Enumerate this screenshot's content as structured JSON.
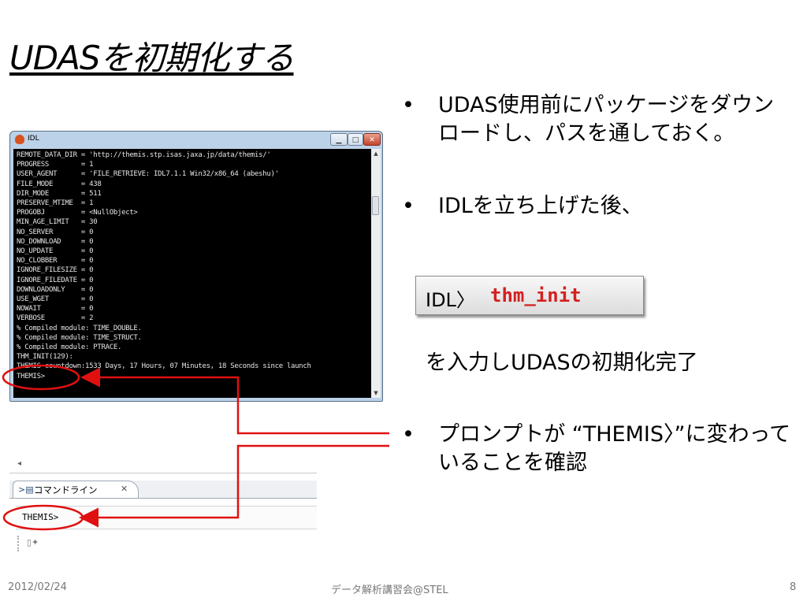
{
  "title": "UDASを初期化する",
  "idl_window": {
    "title": "IDL",
    "console_lines": [
      "REMOTE_DATA_DIR = 'http://themis.stp.isas.jaxa.jp/data/themis/'",
      "PROGRESS        = 1",
      "USER_AGENT      = 'FILE_RETRIEVE: IDL7.1.1 Win32/x86_64 (abeshu)'",
      "FILE_MODE       = 438",
      "DIR_MODE        = 511",
      "PRESERVE_MTIME  = 1",
      "PROGOBJ         = <NullObject>",
      "MIN_AGE_LIMIT   = 30",
      "NO_SERVER       = 0",
      "NO_DOWNLOAD     = 0",
      "NO_UPDATE       = 0",
      "NO_CLOBBER      = 0",
      "IGNORE_FILESIZE = 0",
      "IGNORE_FILEDATE = 0",
      "DOWNLOADONLY    = 0",
      "USE_WGET        = 0",
      "NOWAIT          = 0",
      "VERBOSE         = 2",
      "% Compiled module: TIME_DOUBLE.",
      "% Compiled module: TIME_STRUCT.",
      "% Compiled module: PTRACE.",
      "THM_INIT(129):",
      "THEMIS countdown:1533 Days, 17 Hours, 07 Minutes, 18 Seconds since launch",
      "THEMIS>"
    ]
  },
  "eclipse_panel": {
    "tab_label": "コマンドライン",
    "prompt": "THEMIS>"
  },
  "bullets": {
    "b1": "UDAS使用前にパッケージをダウンロードし、パスを通しておく。",
    "b2": "IDLを立ち上げた後、",
    "b3": "プロンプトが “THEMIS〉”に変わっていることを確認"
  },
  "command": {
    "prefix": "IDL〉",
    "text": "thm_init"
  },
  "complete_text": "を入力しUDASの初期化完了",
  "footer": {
    "date": "2012/02/24",
    "center": "データ解析講習会@STEL",
    "page": "8"
  },
  "colors": {
    "command_red": "#d42020",
    "annotation_red": "#e01010"
  }
}
